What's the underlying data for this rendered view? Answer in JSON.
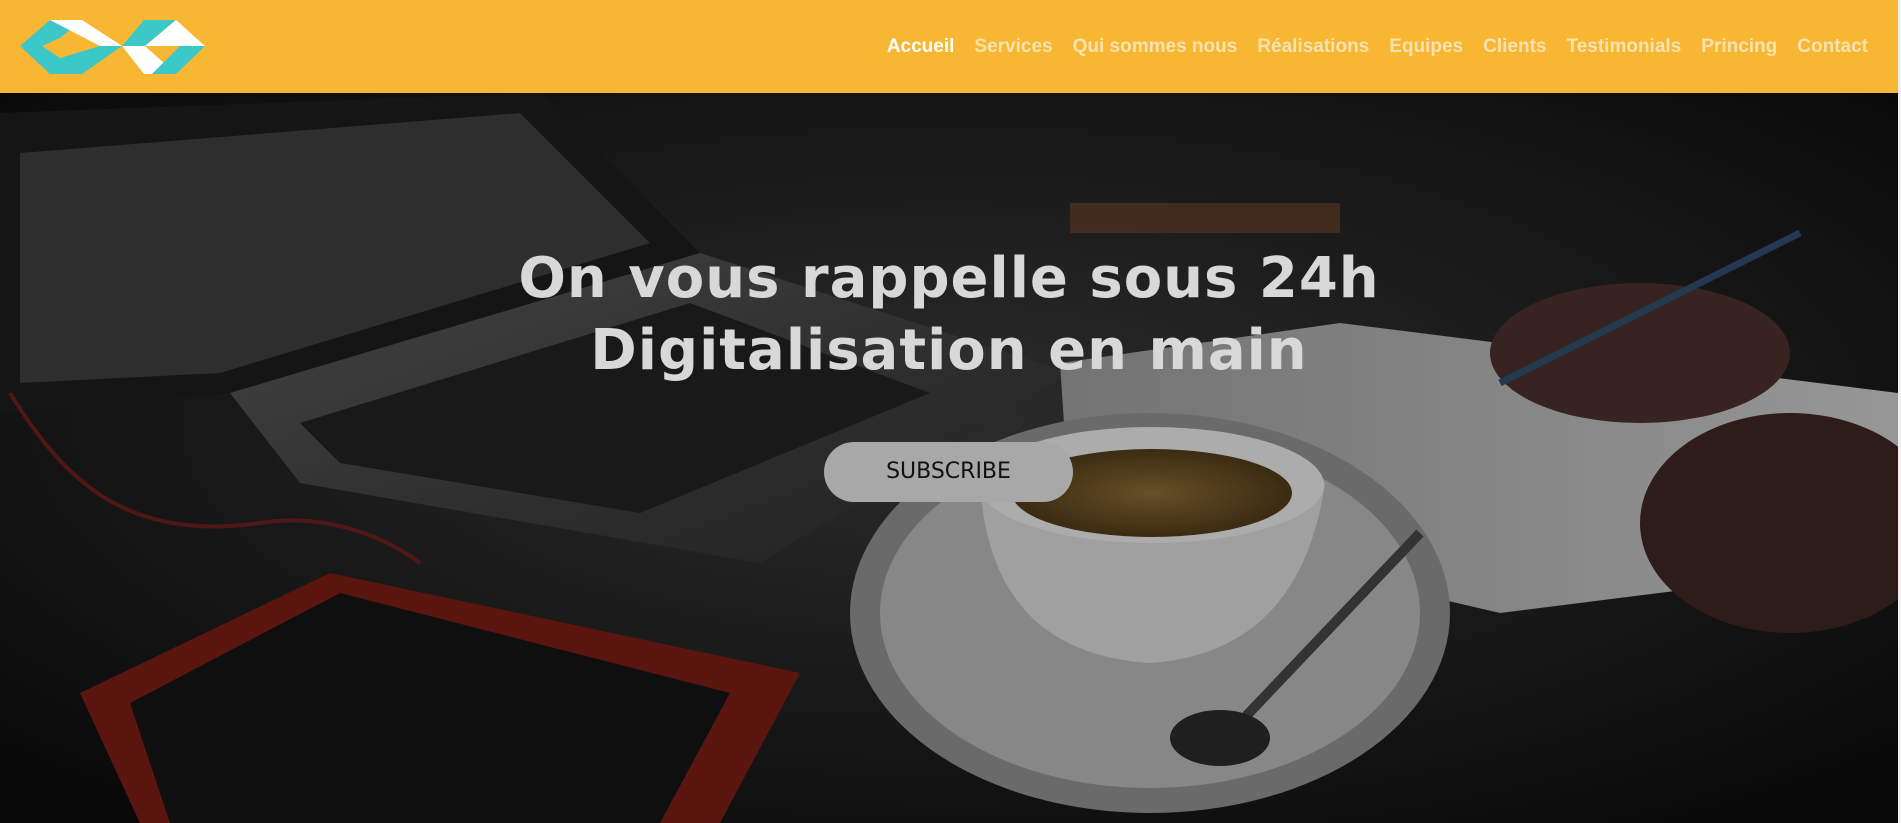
{
  "navbar": {
    "logo_icon": "infinity-logo-icon",
    "links": [
      {
        "label": "Accueil",
        "active": true
      },
      {
        "label": "Services",
        "active": false
      },
      {
        "label": "Qui sommes nous",
        "active": false
      },
      {
        "label": "Réalisations",
        "active": false
      },
      {
        "label": "Equipes",
        "active": false
      },
      {
        "label": "Clients",
        "active": false
      },
      {
        "label": "Testimonials",
        "active": false
      },
      {
        "label": "Princing",
        "active": false
      },
      {
        "label": "Contact",
        "active": false
      }
    ]
  },
  "hero": {
    "title_line1": "On vous rappelle sous 24h",
    "title_line2": "Digitalisation en main",
    "cta_label": "SUBSCRIBE"
  },
  "colors": {
    "header_bg": "#F8B732",
    "nav_active": "#FFFFFF",
    "nav_inactive": "#F7E2B2",
    "logo_teal": "#3CC8C8",
    "logo_white": "#FFFFFF",
    "cta_bg": "#A8A8A8"
  }
}
